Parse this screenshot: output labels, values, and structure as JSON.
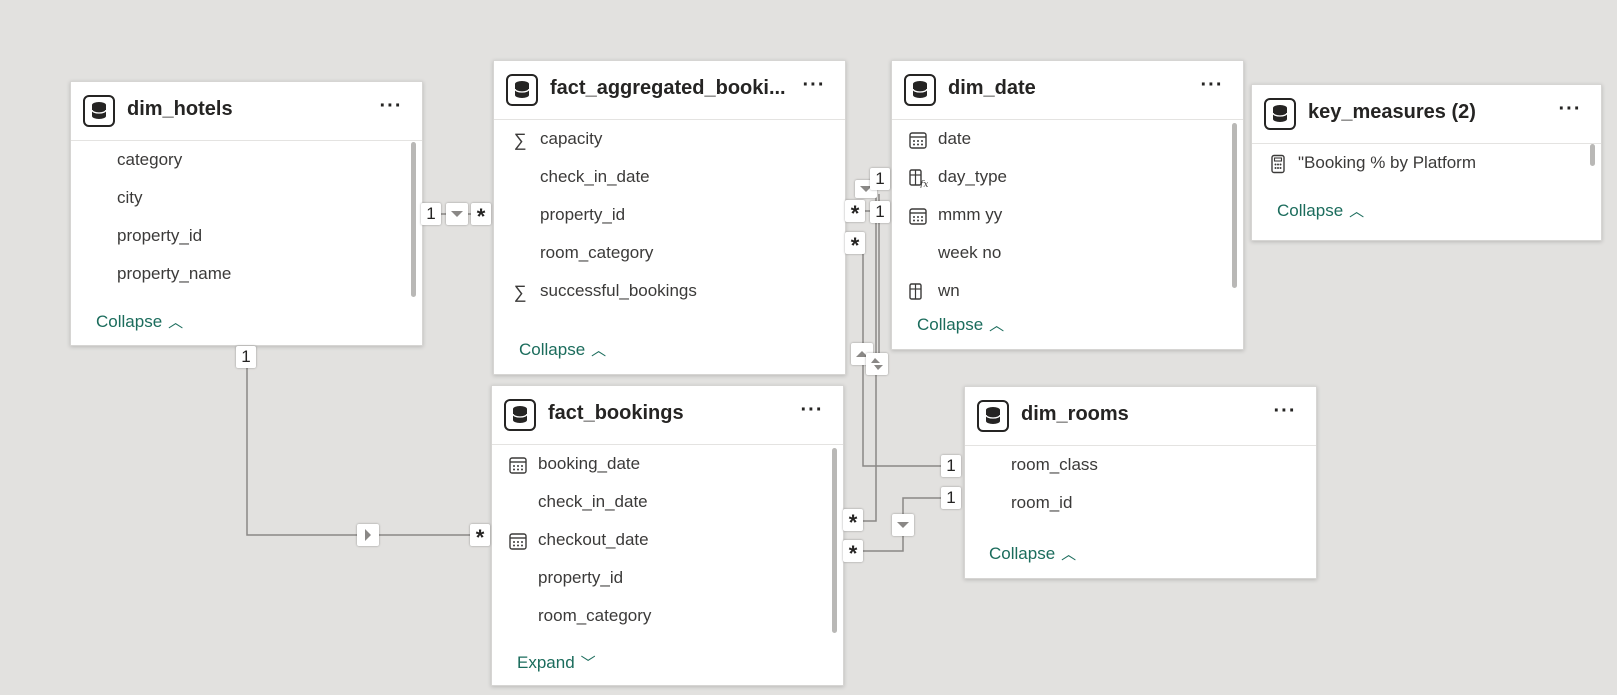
{
  "tables": {
    "dim_hotels": {
      "title": "dim_hotels",
      "fields": [
        "category",
        "city",
        "property_id",
        "property_name"
      ],
      "toggle": "Collapse"
    },
    "fact_aggregated": {
      "title": "fact_aggregated_booki...",
      "fields": [
        "capacity",
        "check_in_date",
        "property_id",
        "room_category",
        "successful_bookings"
      ],
      "field_icons": [
        "sigma-icon",
        "",
        "",
        "",
        "sigma-icon"
      ],
      "toggle": "Collapse"
    },
    "dim_date": {
      "title": "dim_date",
      "fields": [
        "date",
        "day_type",
        "mmm yy",
        "week no",
        "wn"
      ],
      "field_icons": [
        "calendar-icon",
        "calculated-column-icon",
        "calendar-icon",
        "",
        "calculated-column-icon"
      ],
      "toggle": "Collapse"
    },
    "key_measures": {
      "title": "key_measures (2)",
      "fields": [
        "\"Booking % by Platform"
      ],
      "field_icons": [
        "calculator-icon"
      ],
      "toggle": "Collapse"
    },
    "fact_bookings": {
      "title": "fact_bookings",
      "fields": [
        "booking_date",
        "check_in_date",
        "checkout_date",
        "property_id",
        "room_category"
      ],
      "field_icons": [
        "calendar-icon",
        "",
        "calendar-icon",
        "",
        ""
      ],
      "toggle": "Expand"
    },
    "dim_rooms": {
      "title": "dim_rooms",
      "fields": [
        "room_class",
        "room_id"
      ],
      "toggle": "Collapse"
    }
  },
  "cardinality": {
    "one": "1",
    "many": "*"
  },
  "colors": {
    "canvas": "#e2e1df",
    "line": "#8a8886",
    "toggle_text": "#1b6c5c"
  }
}
